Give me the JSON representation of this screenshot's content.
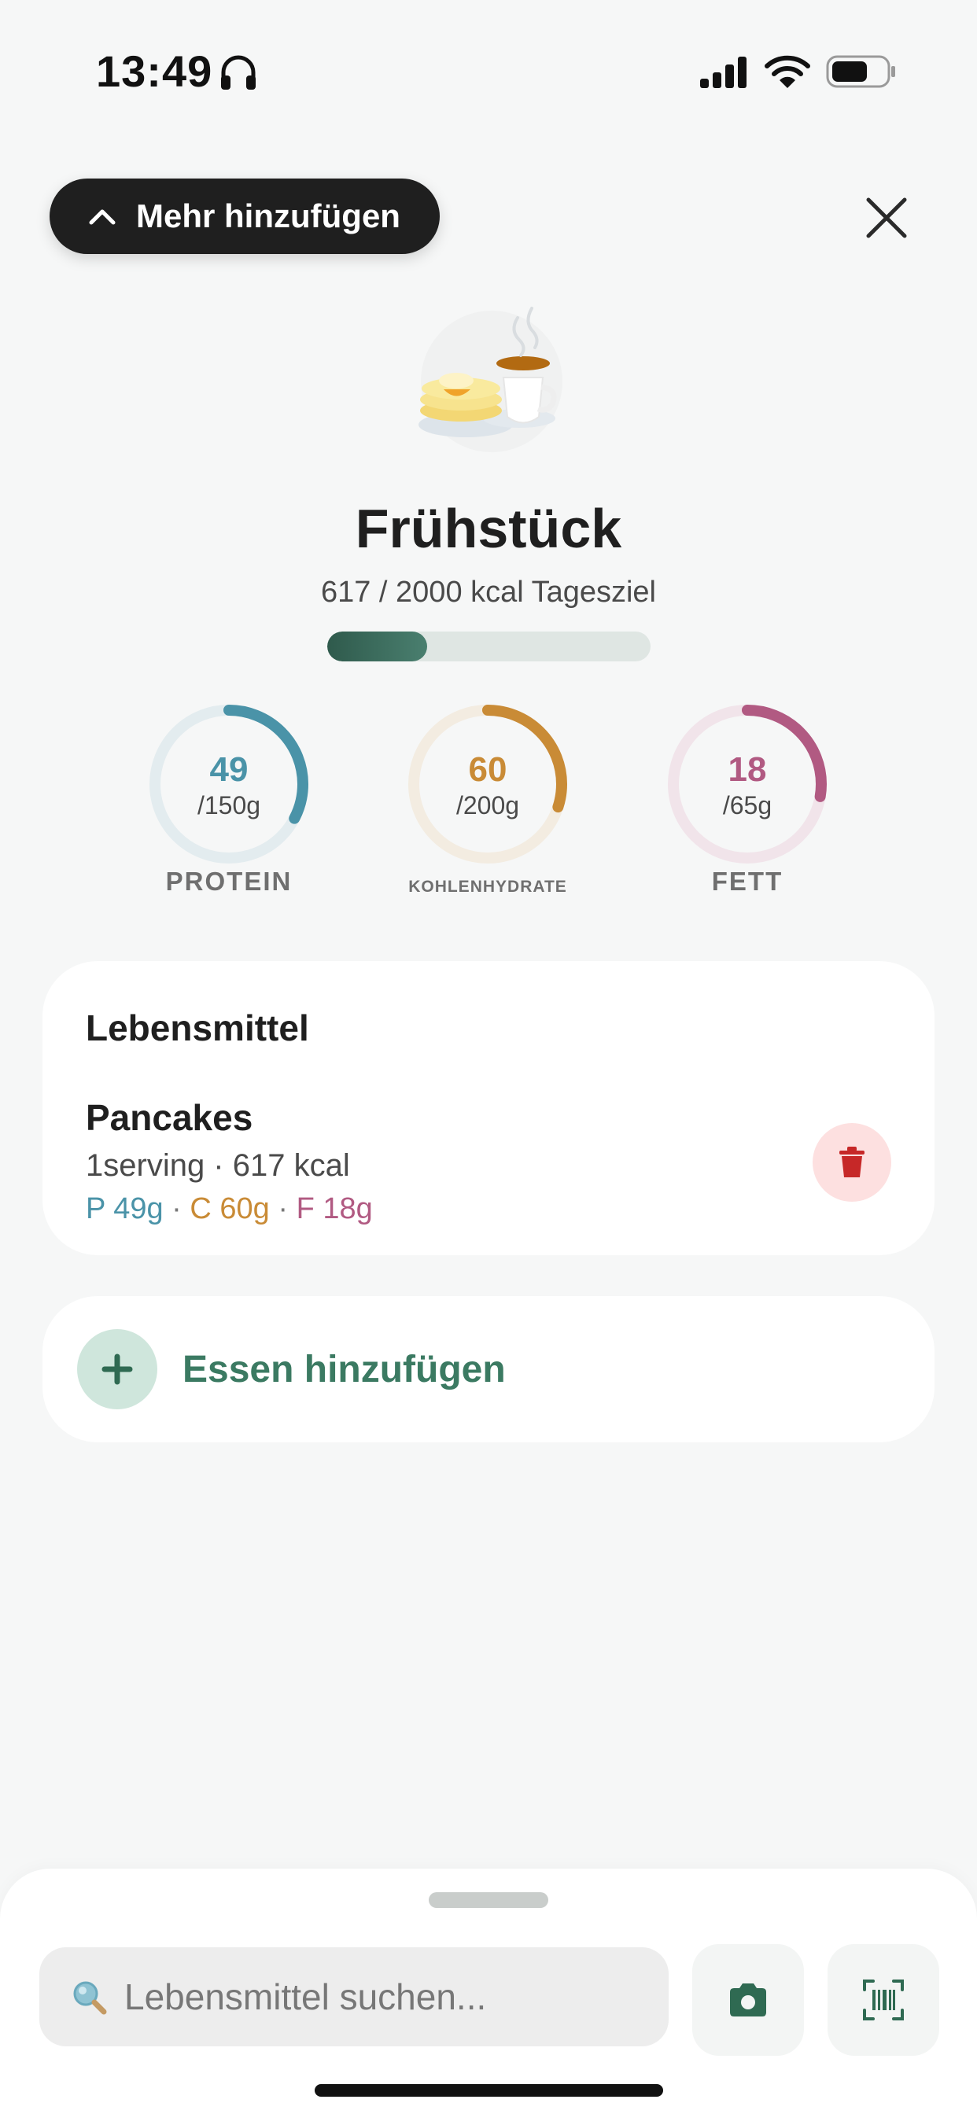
{
  "status_bar": {
    "time": "13:49"
  },
  "header": {
    "more_label": "Mehr hinzufügen"
  },
  "meal": {
    "title": "Frühstück",
    "subtitle": "617 / 2000 kcal Tagesziel",
    "kcal_progress": 0.3085
  },
  "macros": {
    "protein": {
      "value": "49",
      "goal": "/150g",
      "label": "PROTEIN",
      "fraction": 0.3267,
      "color": "#4a93a8",
      "track": "#e3ecef"
    },
    "carbs": {
      "value": "60",
      "goal": "/200g",
      "label": "KOHLENHYDRATE",
      "fraction": 0.3,
      "color": "#c98b36",
      "track": "#f3ece1"
    },
    "fat": {
      "value": "18",
      "goal": "/65g",
      "label": "FETT",
      "fraction": 0.2769,
      "color": "#b15a82",
      "track": "#f1e4ea"
    }
  },
  "foods": {
    "section_title": "Lebensmittel",
    "items": [
      {
        "name": "Pancakes",
        "meta": "1serving · 617 kcal",
        "p": "P 49g",
        "c": "C 60g",
        "f": "F 18g",
        "sep": " · "
      }
    ]
  },
  "add_food": {
    "label": "Essen hinzufügen"
  },
  "search": {
    "placeholder": "Lebensmittel suchen..."
  },
  "colors": {
    "accent_green": "#3b7a62",
    "protein": "#4a93a8",
    "carbs": "#c98b36",
    "fat": "#b15a82",
    "delete_red": "#c62828"
  }
}
